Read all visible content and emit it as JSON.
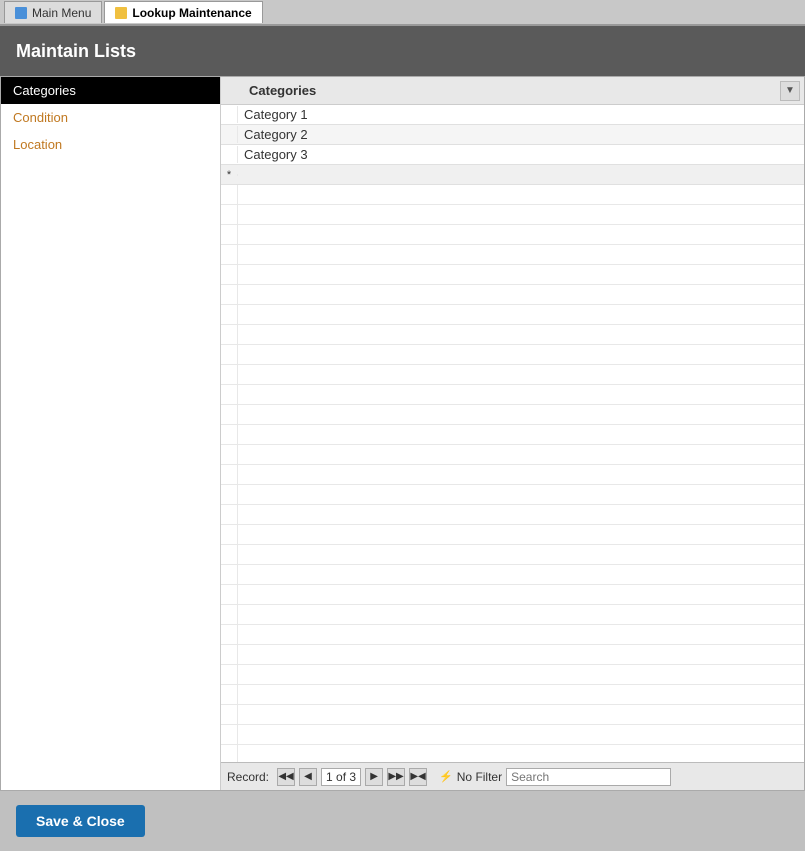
{
  "tabBar": {
    "tabs": [
      {
        "id": "main-menu",
        "label": "Main Menu",
        "iconType": "main",
        "active": false
      },
      {
        "id": "lookup-maintenance",
        "label": "Lookup Maintenance",
        "iconType": "lookup",
        "active": true
      }
    ]
  },
  "pageHeader": {
    "title": "Maintain Lists"
  },
  "sidebar": {
    "items": [
      {
        "id": "categories",
        "label": "Categories",
        "selected": true
      },
      {
        "id": "condition",
        "label": "Condition",
        "selected": false
      },
      {
        "id": "location",
        "label": "Location",
        "selected": false
      }
    ]
  },
  "grid": {
    "columnHeader": "Categories",
    "dropdownArrow": "▼",
    "rows": [
      {
        "value": "Category 1"
      },
      {
        "value": "Category 2"
      },
      {
        "value": "Category 3"
      }
    ],
    "newRowIndicator": "*"
  },
  "navBar": {
    "recordLabel": "Record:",
    "firstBtn": "◀◀",
    "prevBtn": "◀",
    "recordDisplay": "1 of 3",
    "nextBtn": "▶",
    "lastBtn": "▶▶",
    "endBtn": "▶◀",
    "filterIcon": "⚡",
    "filterLabel": "No Filter",
    "searchPlaceholder": "Search"
  },
  "footer": {
    "saveCloseLabel": "Save & Close"
  }
}
